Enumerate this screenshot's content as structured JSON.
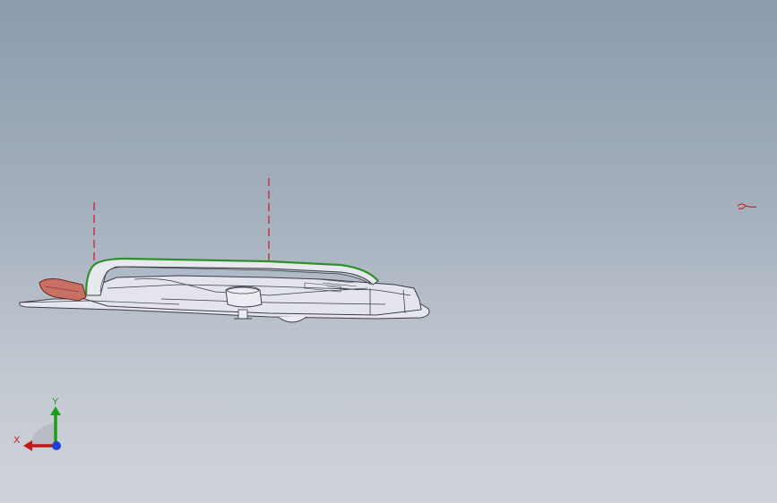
{
  "viewport": {
    "background_top": "#8c9bad",
    "background_bottom": "#cfd3d9"
  },
  "model": {
    "outline_color": "#3c3f48",
    "face_color": "#e4e4ec",
    "highlight_edge_color": "#2f8f2f",
    "highlight_face_color": "#c87064",
    "sketch_line_color": "#d0202a"
  },
  "triad": {
    "x_label": "X",
    "y_label": "Y",
    "x_color": "#c21818",
    "y_color": "#1a9e1a",
    "z_color": "#1f3fd8",
    "icon": "coordinate-triad-icon"
  }
}
